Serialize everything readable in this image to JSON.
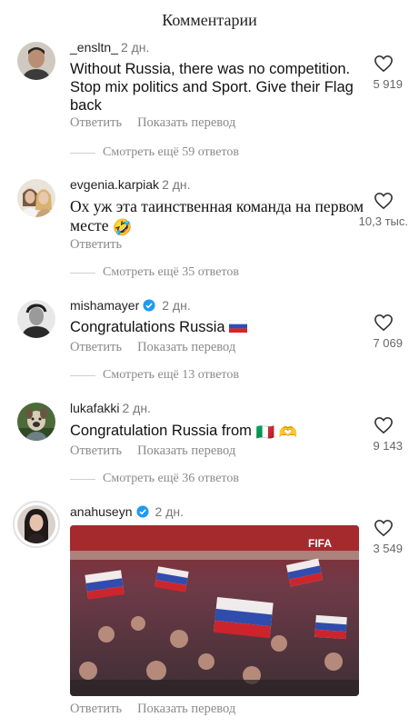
{
  "header": {
    "title": "Комментарии"
  },
  "comments": [
    {
      "username": "_ensltn_",
      "time": "2 дн.",
      "text": "Without Russia, there was no competition. Stop mix politics and Sport. Give their Flag back",
      "reply_label": "Ответить",
      "translate_label": "Показать перевод",
      "likes": "5 919",
      "replies_label": "Смотреть ещё 59 ответов",
      "avatar": "man-portrait-avatar"
    },
    {
      "username": "evgenia.karpiak",
      "time": "2 дн.",
      "text": "Ох уж эта таинственная команда на первом месте",
      "emoji": "🤣",
      "reply_label": "Ответить",
      "likes": "10,3 тыс.",
      "replies_label": "Смотреть ещё 35 ответов",
      "avatar": "couple-selfie-avatar"
    },
    {
      "username": "mishamayer",
      "verified": true,
      "time": "2 дн.",
      "text": "Congratulations Russia",
      "emoji": "🇷🇺",
      "reply_label": "Ответить",
      "translate_label": "Показать перевод",
      "likes": "7 069",
      "replies_label": "Смотреть ещё 13 ответов",
      "avatar": "bw-man-avatar"
    },
    {
      "username": "lukafakki",
      "time": "2 дн.",
      "text": "Congratulation Russia from",
      "emoji": "🇮🇹 🫶",
      "reply_label": "Ответить",
      "translate_label": "Показать перевод",
      "likes": "9 143",
      "replies_label": "Смотреть ещё 36 ответов",
      "avatar": "dog-avatar"
    },
    {
      "username": "anahuseyn",
      "verified": true,
      "time": "2 дн.",
      "reply_label": "Ответить",
      "translate_label": "Показать перевод",
      "likes": "3 549",
      "media_label": "FIFA",
      "avatar": "woman-portrait-avatar"
    }
  ],
  "colors": {
    "verified": "#1d9bf0",
    "muted": "#8a8a8a",
    "flag_white": "#ffffff",
    "flag_blue": "#2b4fb8",
    "flag_red": "#d8232a"
  }
}
